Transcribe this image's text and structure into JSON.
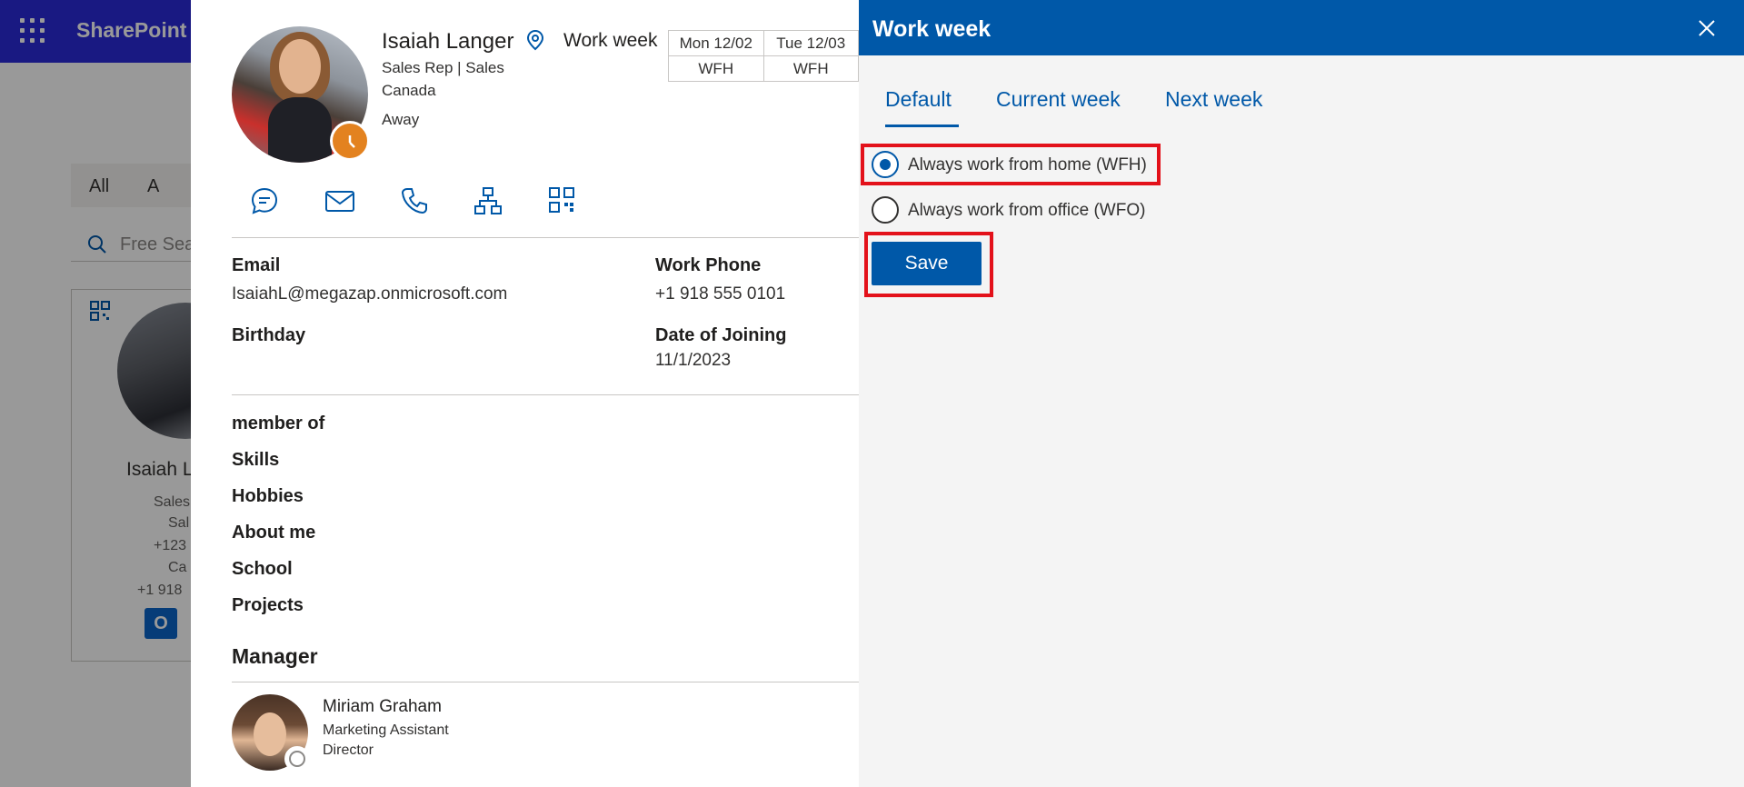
{
  "app": {
    "name": "SharePoint"
  },
  "background": {
    "tabs": [
      "All",
      "A"
    ],
    "search_placeholder": "Free Sea",
    "card": {
      "name": "Isaiah L",
      "lines": [
        "Sales",
        "Sal",
        "+123",
        "Ca",
        "+1 918"
      ]
    }
  },
  "profile": {
    "name": "Isaiah Langer",
    "title_line": "Sales Rep | Sales",
    "country": "Canada",
    "status": "Away",
    "work_week_label": "Work week",
    "work_week_table": {
      "headers": [
        "Mon 12/02",
        "Tue 12/03"
      ],
      "values": [
        "WFH",
        "WFH"
      ]
    },
    "actions": [
      "chat-icon",
      "mail-icon",
      "phone-icon",
      "org-chart-icon",
      "qr-code-icon"
    ],
    "fields": {
      "email_label": "Email",
      "email_value": "IsaiahL@megazap.onmicrosoft.com",
      "work_phone_label": "Work Phone",
      "work_phone_value": "+1 918 555 0101",
      "birthday_label": "Birthday",
      "doj_label": "Date of Joining",
      "doj_value": "11/1/2023"
    },
    "sections": [
      "member of",
      "Skills",
      "Hobbies",
      "About me",
      "School",
      "Projects"
    ],
    "manager": {
      "heading": "Manager",
      "name": "Miriam Graham",
      "line1": "Marketing Assistant",
      "line2": "Director"
    }
  },
  "work_week_panel": {
    "title": "Work week",
    "tabs": [
      {
        "label": "Default",
        "active": true
      },
      {
        "label": "Current week",
        "active": false
      },
      {
        "label": "Next week",
        "active": false
      }
    ],
    "options": [
      {
        "label": "Always work from home (WFH)",
        "selected": true
      },
      {
        "label": "Always work from office (WFO)",
        "selected": false
      }
    ],
    "save_label": "Save"
  },
  "colors": {
    "accent": "#0058a8",
    "suite_bar": "#2b2bd9",
    "highlight": "#e3111a",
    "away": "#e3821f"
  }
}
